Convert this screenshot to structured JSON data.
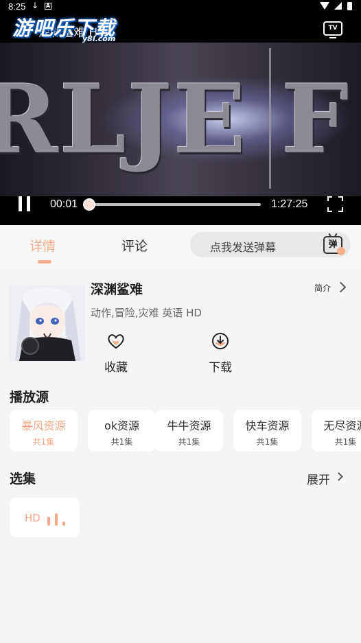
{
  "status_bar": {
    "time": "8:25"
  },
  "video": {
    "title": "深渊鲨难 HD",
    "watermark": "游吧乐下载",
    "watermark_sub": "y8l.com",
    "tv_label": "TV",
    "frame_text": "RLJE F",
    "current_time": "00:01",
    "total_time": "1:27:25",
    "progress": 0.01
  },
  "tabs": [
    {
      "label": "详情",
      "active": true
    },
    {
      "label": "评论",
      "active": false
    }
  ],
  "danmaku": {
    "placeholder": "点我发送弹幕",
    "icon_label": "弹"
  },
  "movie": {
    "title": "深渊鲨难",
    "intro_label": "简介",
    "meta": "动作,冒险,灾难 英语 HD"
  },
  "actions": {
    "favorite": "收藏",
    "download": "下载"
  },
  "sources": {
    "title": "播放源",
    "items": [
      {
        "name": "暴风资源",
        "count": "共1集",
        "active": true
      },
      {
        "name": "ok资源",
        "count": "共1集",
        "active": false
      },
      {
        "name": "牛牛资源",
        "count": "共1集",
        "active": false
      },
      {
        "name": "快车资源",
        "count": "共1集",
        "active": false
      },
      {
        "name": "无尽资源",
        "count": "共1集",
        "active": false
      }
    ]
  },
  "episodes": {
    "title": "选集",
    "expand_label": "展开",
    "items": [
      {
        "label": "HD"
      }
    ]
  },
  "colors": {
    "accent": "#f7b08d",
    "accent_text": "#f5a788",
    "background": "#f5f5f5"
  }
}
